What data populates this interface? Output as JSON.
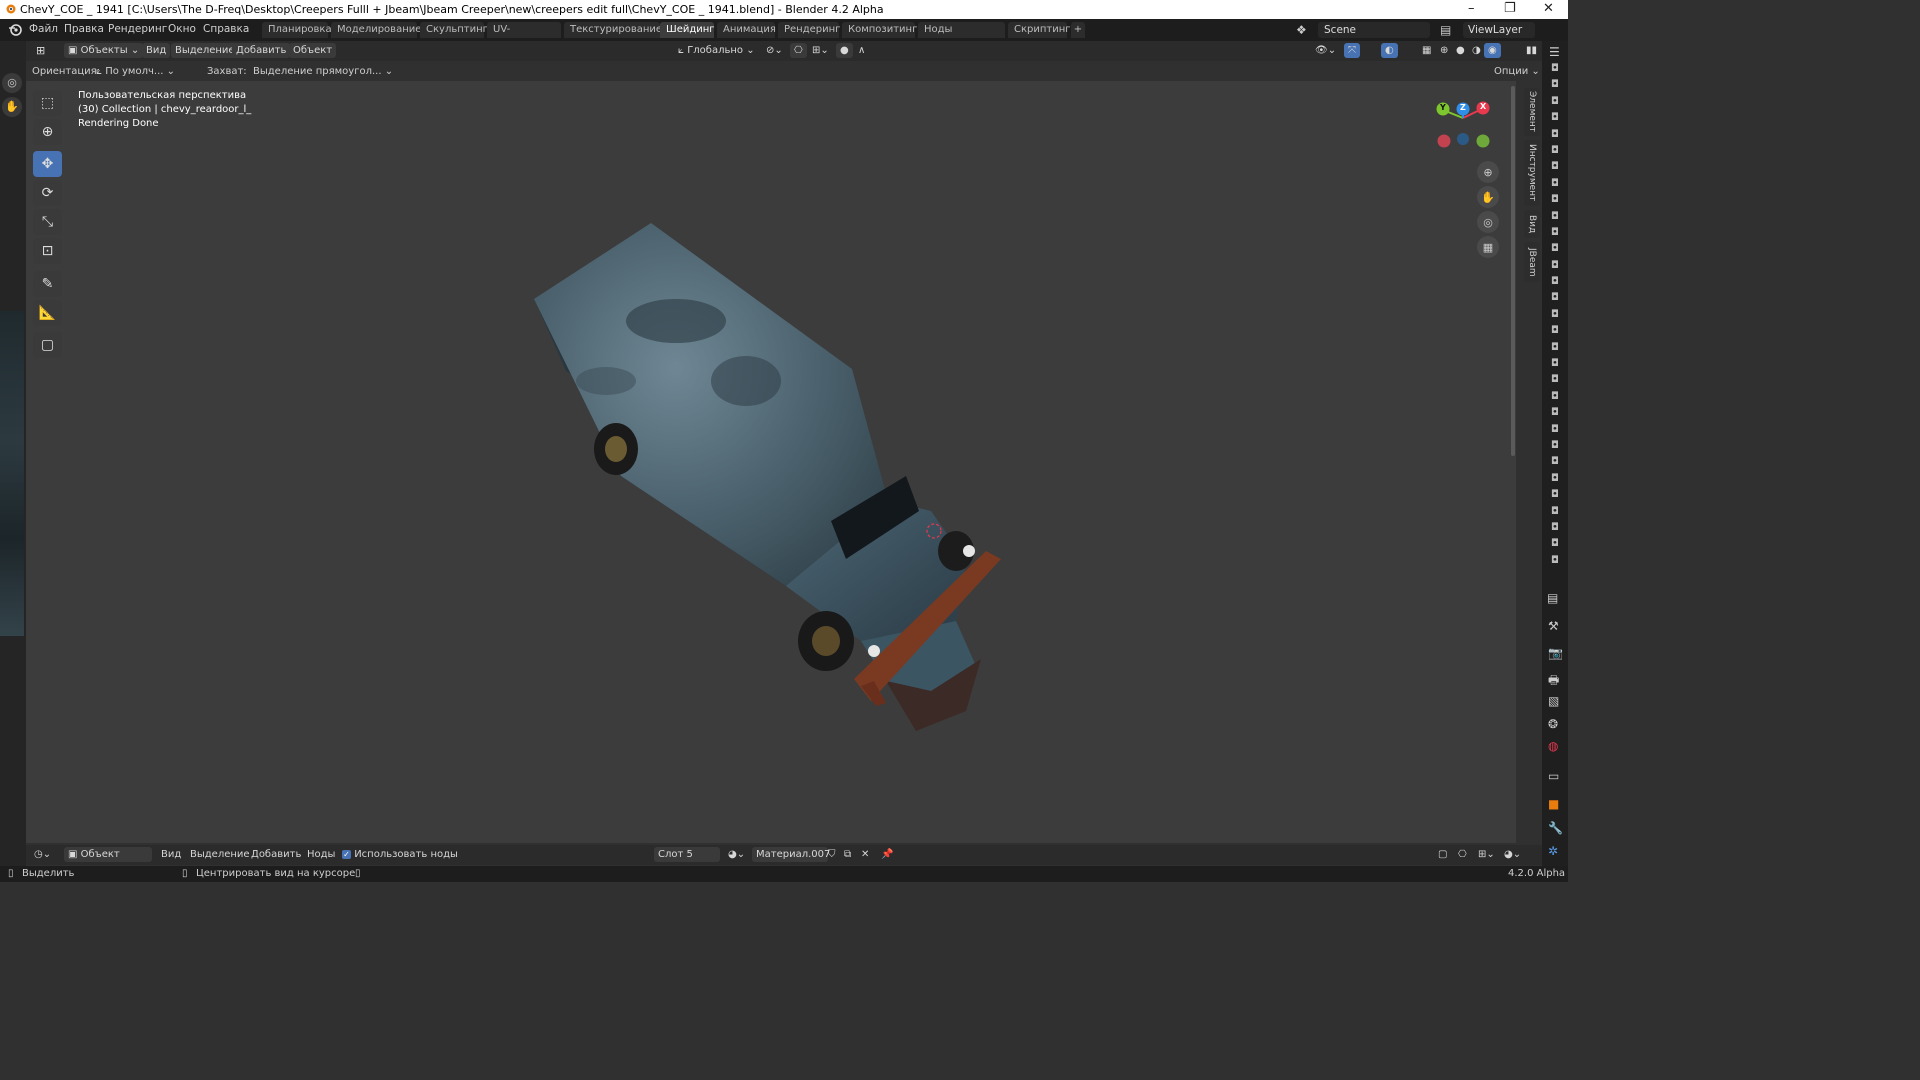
{
  "window": {
    "title": "ChevY_COE _ 1941 [C:\\Users\\The D-Freq\\Desktop\\Creepers Fulll + Jbeam\\Jbeam Creeper\\new\\creepers edit full\\ChevY_COE _ 1941.blend] - Blender 4.2 Alpha",
    "minimize": "–",
    "maximize": "❐",
    "close": "✕"
  },
  "menu": {
    "items": [
      "Файл",
      "Правка",
      "Рендеринг",
      "Окно",
      "Справка"
    ]
  },
  "workspaces": {
    "tabs": [
      "Планировка",
      "Моделирование",
      "Скульптинг",
      "UV-редактор",
      "Текстурирование",
      "Шейдинг",
      "Анимация",
      "Рендеринг",
      "Композитинг",
      "Ноды геометрии",
      "Скриптинг"
    ],
    "active": "Шейдинг",
    "add": "+"
  },
  "scene": {
    "name": "Scene",
    "view_layer": "ViewLayer"
  },
  "header": {
    "mode": "Объекты",
    "view": "Вид",
    "select": "Выделение",
    "add": "Добавить",
    "object": "Объект",
    "transform": "Глобально"
  },
  "subheader": {
    "orientation_label": "Ориентация:",
    "orientation_value": "По умолч...",
    "snap_label": "Захват:",
    "snap_value": "Выделение прямоугол...",
    "options": "Опции"
  },
  "viewport": {
    "overlay_line1": "Пользовательская перспектива",
    "overlay_line2": "(30) Collection | chevy_reardoor_l_",
    "overlay_line3": "Rendering Done",
    "gizmo_y": "Y",
    "gizmo_z": "Z",
    "gizmo_x": "X"
  },
  "sidebar_tabs": [
    "Элемент",
    "Инструмент",
    "Вид",
    "JBeam"
  ],
  "bottom": {
    "editor": "Объект",
    "view": "Вид",
    "select": "Выделение",
    "add": "Добавить",
    "nodes": "Ноды",
    "use_nodes": "Использовать ноды",
    "slot": "Слот 5",
    "material": "Материал.007"
  },
  "status": {
    "select": "Выделить",
    "center": "Центрировать вид на курсоре",
    "version": "4.2.0 Alpha"
  },
  "colors": {
    "accent": "#4772b3",
    "axis_x": "#e8394f",
    "axis_y": "#7ec62d",
    "axis_z": "#2f8fe8"
  }
}
